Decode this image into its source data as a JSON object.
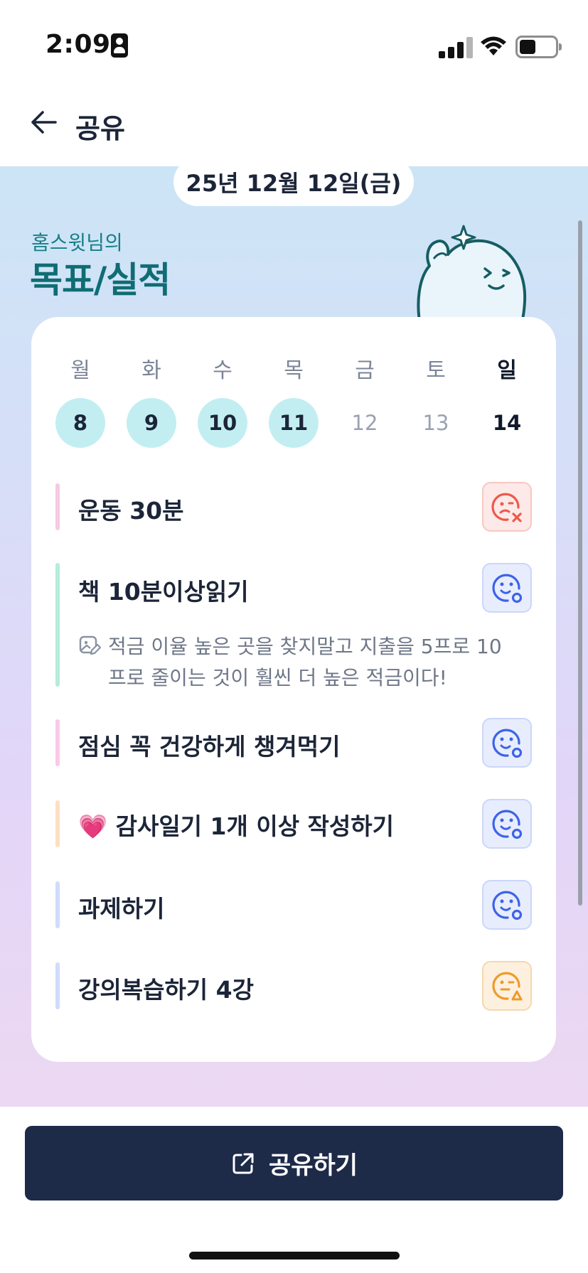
{
  "status_bar": {
    "time": "2:09"
  },
  "header": {
    "title": "공유"
  },
  "date_pill": "25년 12월 12일(금)",
  "owner_label": "홈스윗님의",
  "section_title": "목표/실적",
  "week": {
    "days": [
      "월",
      "화",
      "수",
      "목",
      "금",
      "토",
      "일"
    ],
    "dates": [
      "8",
      "9",
      "10",
      "11",
      "12",
      "13",
      "14"
    ]
  },
  "goals": [
    {
      "title": "운동 30분",
      "status_icon": "sad-face-x-icon",
      "bar_color": "#f7c9e3"
    },
    {
      "title": "책 10분이상읽기",
      "status_icon": "smile-face-o-icon",
      "bar_color": "#b6ecd9",
      "memo": "적금 이율 높은 곳을 찾지말고 지출을 5프로 10프로 줄이는 것이 훨씬 더 높은 적금이다!"
    },
    {
      "title": "점심 꼭 건강하게 챙겨먹기",
      "status_icon": "smile-face-o-icon",
      "bar_color": "#f9c9e8"
    },
    {
      "emoji": "💗",
      "title": "감사일기 1개 이상 작성하기",
      "status_icon": "smile-face-o-icon",
      "bar_color": "#fde0c2"
    },
    {
      "title": "과제하기",
      "status_icon": "smile-face-o-icon",
      "bar_color": "#d0dcfb"
    },
    {
      "title": "강의복습하기 4강",
      "status_icon": "neutral-face-triangle-icon",
      "bar_color": "#d0dcfb"
    }
  ],
  "share_button": {
    "label": "공유하기"
  },
  "colors": {
    "accent": "#1d2a48",
    "done_day": "#c2eef2",
    "title_teal": "#0f6d73",
    "fail": "#ea5a4a",
    "success": "#3d63e8",
    "partial": "#ef9a2c"
  }
}
